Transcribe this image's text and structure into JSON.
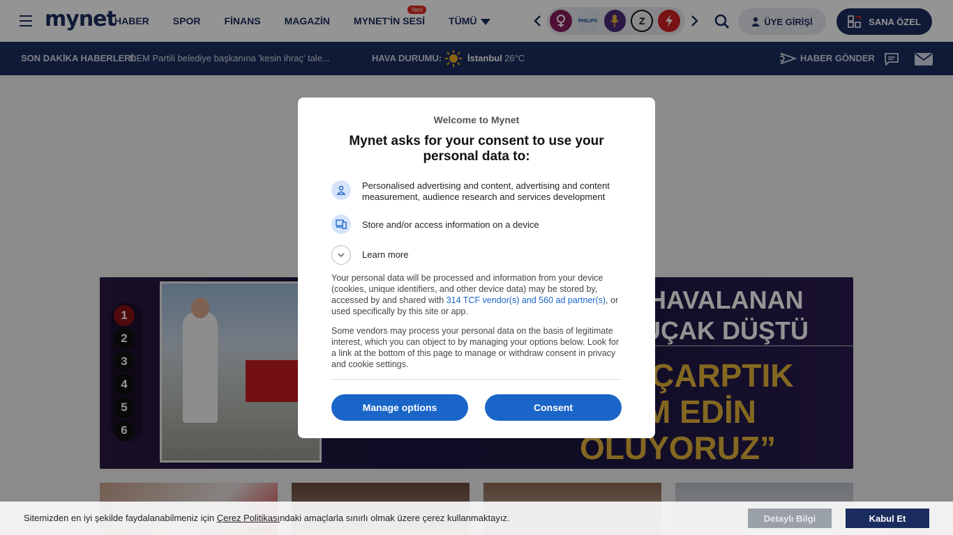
{
  "header": {
    "logo": "mynet",
    "nav": [
      {
        "label": "HABER"
      },
      {
        "label": "SPOR"
      },
      {
        "label": "FİNANS"
      },
      {
        "label": "MAGAZİN"
      },
      {
        "label": "MYNET'İN SESİ",
        "badge": "Yeni"
      },
      {
        "label": "TÜMÜ"
      }
    ],
    "apps": [
      {
        "icon": "venus-icon",
        "color": "#8a1a5c"
      },
      {
        "icon": "philips-icon",
        "label": "PHILIPS",
        "color": "#dfe3ea"
      },
      {
        "icon": "microphone-icon",
        "color": "#4a2a7a"
      },
      {
        "icon": "z-icon",
        "label": "Z",
        "color": "#1a1a1a"
      },
      {
        "icon": "bolt-icon",
        "color": "#d01f24"
      }
    ],
    "login_label": "ÜYE GİRİŞİ",
    "personal_label": "SANA ÖZEL"
  },
  "breaking": {
    "label": "SON DAKİKA HABERLERİ:",
    "text": "DEM Partili belediye başkanına 'kesin ihraç' tale...",
    "weather_label": "HAVA DURUMU:",
    "city": "İstanbul",
    "temp": "26°C",
    "send_news": "HABER GÖNDER"
  },
  "slider": {
    "numbers": [
      "1",
      "2",
      "3",
      "4",
      "5",
      "6"
    ],
    "active": 1,
    "headline_lines": [
      "DEN HAVALANAN",
      "UÇAK DÜŞTÜ",
      "ÇARPTIK",
      "M EDİN",
      "OLUYORUZ”"
    ]
  },
  "modal": {
    "welcome": "Welcome to Mynet",
    "title": "Mynet asks for your consent to use your personal data to:",
    "purposes": [
      {
        "icon": "person-icon",
        "text": "Personalised advertising and content, advertising and content measurement, audience research and services development"
      },
      {
        "icon": "devices-icon",
        "text": "Store and/or access information on a device"
      }
    ],
    "learn_more": "Learn more",
    "para1_a": "Your personal data will be processed and information from your device (cookies, unique identifiers, and other device data) may be stored by, accessed by and shared with ",
    "para1_link": "314 TCF vendor(s) and 560 ad partner(s)",
    "para1_b": ", or used specifically by this site or app.",
    "para2": "Some vendors may process your personal data on the basis of legitimate interest, which you can object to by managing your options below. Look for a link at the bottom of this page to manage or withdraw consent in privacy and cookie settings.",
    "manage_label": "Manage options",
    "consent_label": "Consent"
  },
  "cookie": {
    "text_a": "Sitemizden en iyi şekilde faydalanabilmeniz için ",
    "link": "Çerez Politikası",
    "text_b": "ndaki amaçlarla sınırlı olmak üzere çerez kullanmaktayız.",
    "detail_label": "Detaylı Bilgi",
    "accept_label": "Kabul Et"
  },
  "colors": {
    "brand_navy": "#1b2d5e",
    "consent_blue": "#1a65c8",
    "brand_red": "#e0261c"
  }
}
